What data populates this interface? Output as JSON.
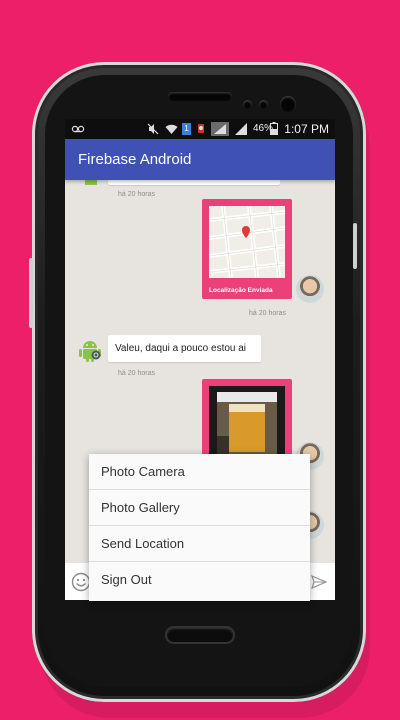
{
  "status_bar": {
    "battery_percent": "46%",
    "time": "1:07 PM",
    "notification_badge": "1"
  },
  "app_bar": {
    "title": "Firebase Android"
  },
  "messages": [
    {
      "direction": "in",
      "time": "há 20 horas"
    },
    {
      "direction": "out",
      "type": "location",
      "caption": "Localização Enviada",
      "time": "há 20 horas"
    },
    {
      "direction": "in",
      "type": "text",
      "text": "Valeu, daqui a pouco estou ai",
      "time": "há 20 horas"
    },
    {
      "direction": "out",
      "type": "image"
    }
  ],
  "menu": {
    "items": [
      {
        "label": "Photo Camera"
      },
      {
        "label": "Photo Gallery"
      },
      {
        "label": "Send Location"
      },
      {
        "label": "Sign Out"
      }
    ]
  },
  "icons": {
    "emoji": "emoji-icon",
    "send": "send-icon"
  },
  "colors": {
    "background": "#ec1f68",
    "app_bar": "#3f51b5",
    "card_accent": "#ec407a",
    "chat_background": "#e7e4df"
  }
}
